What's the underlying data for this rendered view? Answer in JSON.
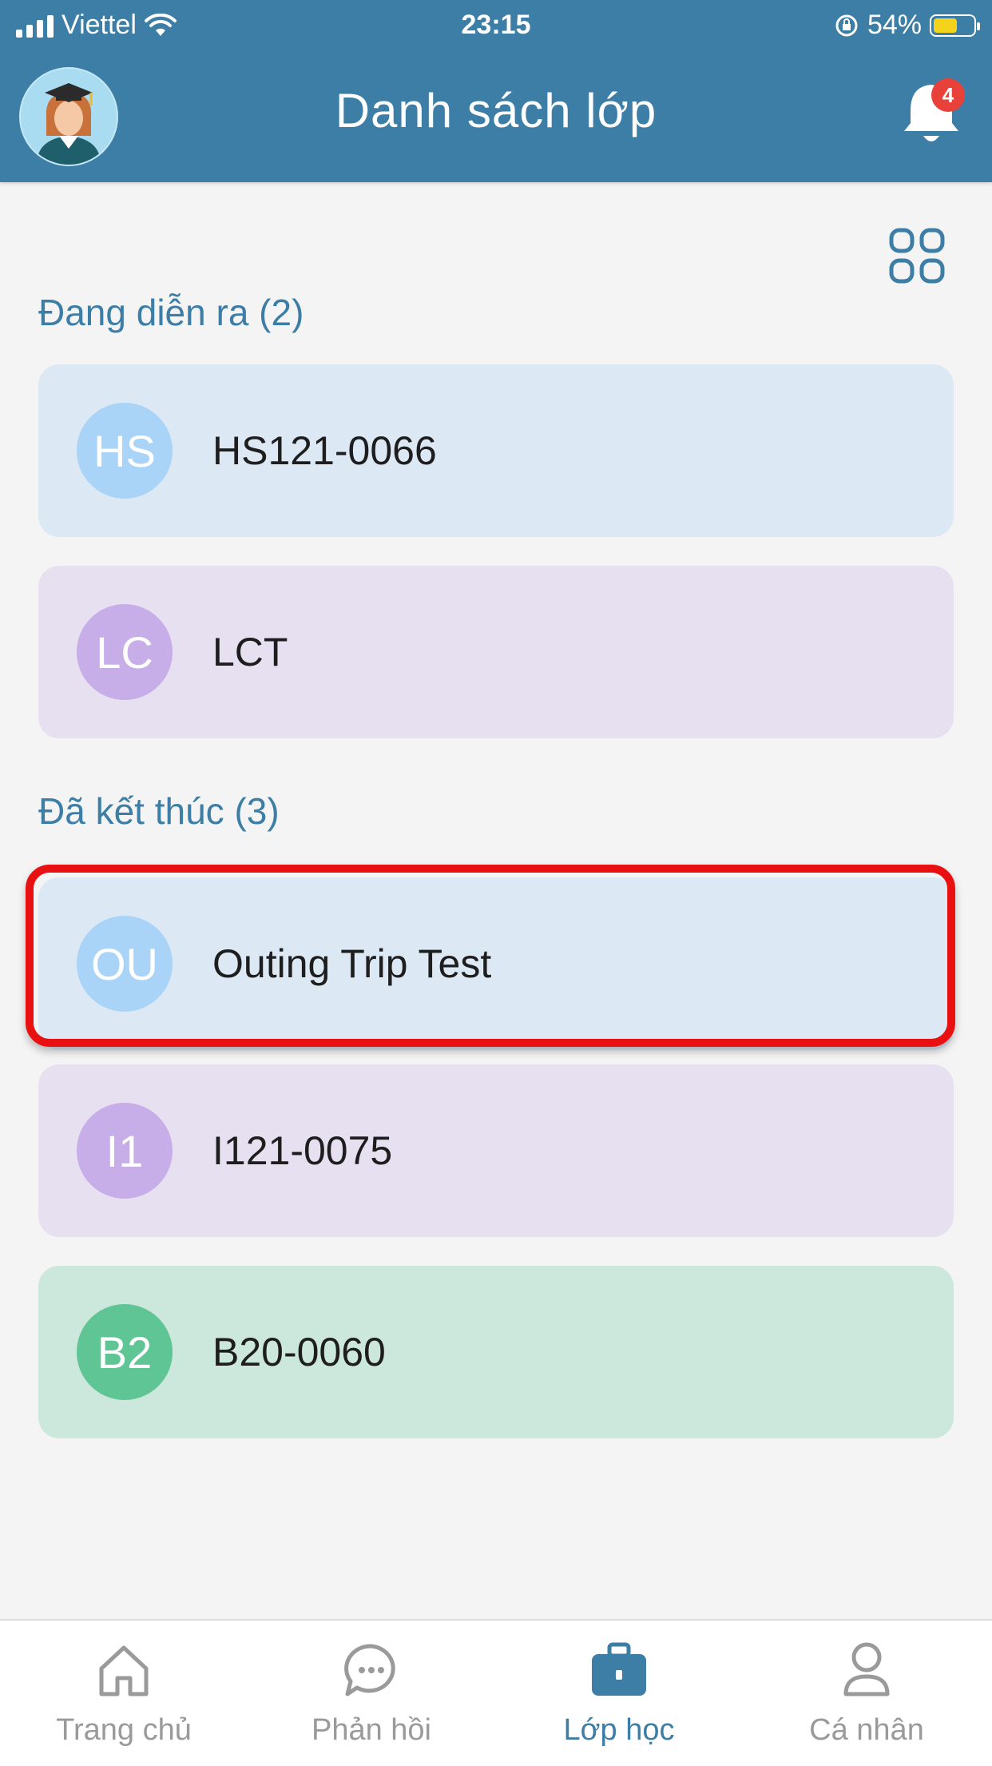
{
  "status_bar": {
    "carrier": "Viettel",
    "time": "23:15",
    "battery_percent": "54%"
  },
  "header": {
    "title": "Danh sách lớp",
    "notification_count": "4"
  },
  "sections": [
    {
      "title": "Đang diễn ra (2)",
      "classes": [
        {
          "initials": "HS",
          "name": "HS121-0066"
        },
        {
          "initials": "LC",
          "name": "LCT"
        }
      ]
    },
    {
      "title": "Đã kết thúc (3)",
      "classes": [
        {
          "initials": "OU",
          "name": "Outing Trip Test"
        },
        {
          "initials": "I1",
          "name": "I121-0075"
        },
        {
          "initials": "B2",
          "name": "B20-0060"
        }
      ]
    }
  ],
  "tabbar": {
    "home": "Trang chủ",
    "feedback": "Phản hồi",
    "classes": "Lớp học",
    "profile": "Cá nhân"
  },
  "colors": {
    "header": "#3d7ea6",
    "badge": "#e8413a",
    "highlight": "#e81010",
    "active_tab": "#3d7ea6"
  }
}
